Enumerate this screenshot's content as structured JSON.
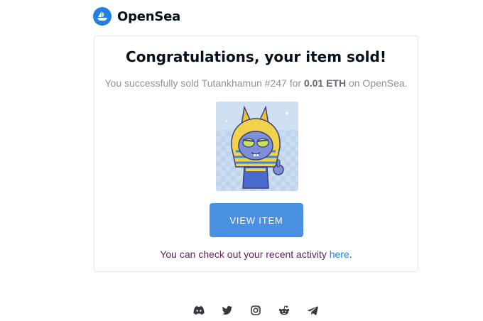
{
  "brand": {
    "name": "OpenSea",
    "logo_icon": "opensea-ship-icon",
    "color": "#2081e2"
  },
  "email": {
    "headline": "Congratulations, your item sold!",
    "sale": {
      "prefix": "You successfully sold Tutankhamun #247 for",
      "price": "0.01 ETH",
      "suffix": "on OpenSea."
    },
    "item_image_icon": "pharaoh-cat-nft-image",
    "view_button_label": "VIEW ITEM",
    "activity": {
      "text": "You can check out your recent activity",
      "link": "here",
      "end": "."
    }
  },
  "socials": [
    {
      "icon": "discord-icon"
    },
    {
      "icon": "twitter-icon"
    },
    {
      "icon": "instagram-icon"
    },
    {
      "icon": "reddit-icon"
    },
    {
      "icon": "telegram-icon"
    }
  ]
}
